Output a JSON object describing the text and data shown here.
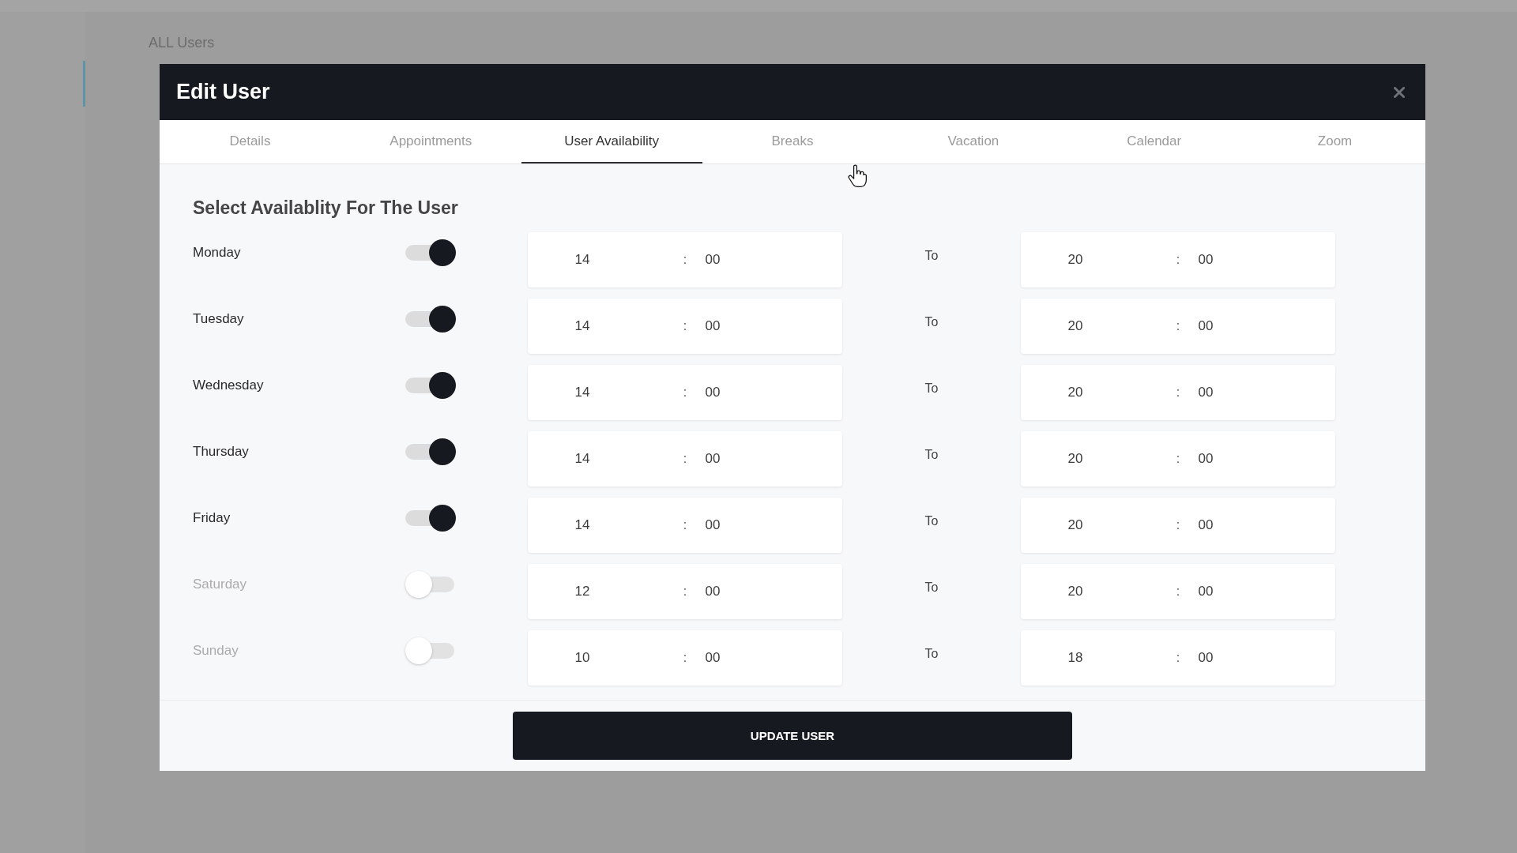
{
  "page": {
    "breadcrumb": "ALL Users"
  },
  "dialog": {
    "title": "Edit User",
    "tabs": [
      {
        "label": "Details",
        "selected": false
      },
      {
        "label": "Appointments",
        "selected": false
      },
      {
        "label": "User Availability",
        "selected": true
      },
      {
        "label": "Breaks",
        "selected": false
      },
      {
        "label": "Vacation",
        "selected": false
      },
      {
        "label": "Calendar",
        "selected": false
      },
      {
        "label": "Zoom",
        "selected": false
      }
    ],
    "heading": "Select Availablity For The User",
    "days": [
      {
        "day": "Monday",
        "on": true,
        "from": {
          "hour": "14",
          "separator": ":",
          "minute": "00"
        },
        "to_label": "To",
        "to": {
          "hour": "20",
          "separator": ":",
          "minute": "00"
        }
      },
      {
        "day": "Tuesday",
        "on": true,
        "from": {
          "hour": "14",
          "separator": ":",
          "minute": "00"
        },
        "to_label": "To",
        "to": {
          "hour": "20",
          "separator": ":",
          "minute": "00"
        }
      },
      {
        "day": "Wednesday",
        "on": true,
        "from": {
          "hour": "14",
          "separator": ":",
          "minute": "00"
        },
        "to_label": "To",
        "to": {
          "hour": "20",
          "separator": ":",
          "minute": "00"
        }
      },
      {
        "day": "Thursday",
        "on": true,
        "from": {
          "hour": "14",
          "separator": ":",
          "minute": "00"
        },
        "to_label": "To",
        "to": {
          "hour": "20",
          "separator": ":",
          "minute": "00"
        }
      },
      {
        "day": "Friday",
        "on": true,
        "from": {
          "hour": "14",
          "separator": ":",
          "minute": "00"
        },
        "to_label": "To",
        "to": {
          "hour": "20",
          "separator": ":",
          "minute": "00"
        }
      },
      {
        "day": "Saturday",
        "on": false,
        "from": {
          "hour": "12",
          "separator": ":",
          "minute": "00"
        },
        "to_label": "To",
        "to": {
          "hour": "20",
          "separator": ":",
          "minute": "00"
        }
      },
      {
        "day": "Sunday",
        "on": false,
        "from": {
          "hour": "10",
          "separator": ":",
          "minute": "00"
        },
        "to_label": "To",
        "to": {
          "hour": "18",
          "separator": ":",
          "minute": "00"
        }
      }
    ],
    "submit": "UPDATE USER"
  }
}
